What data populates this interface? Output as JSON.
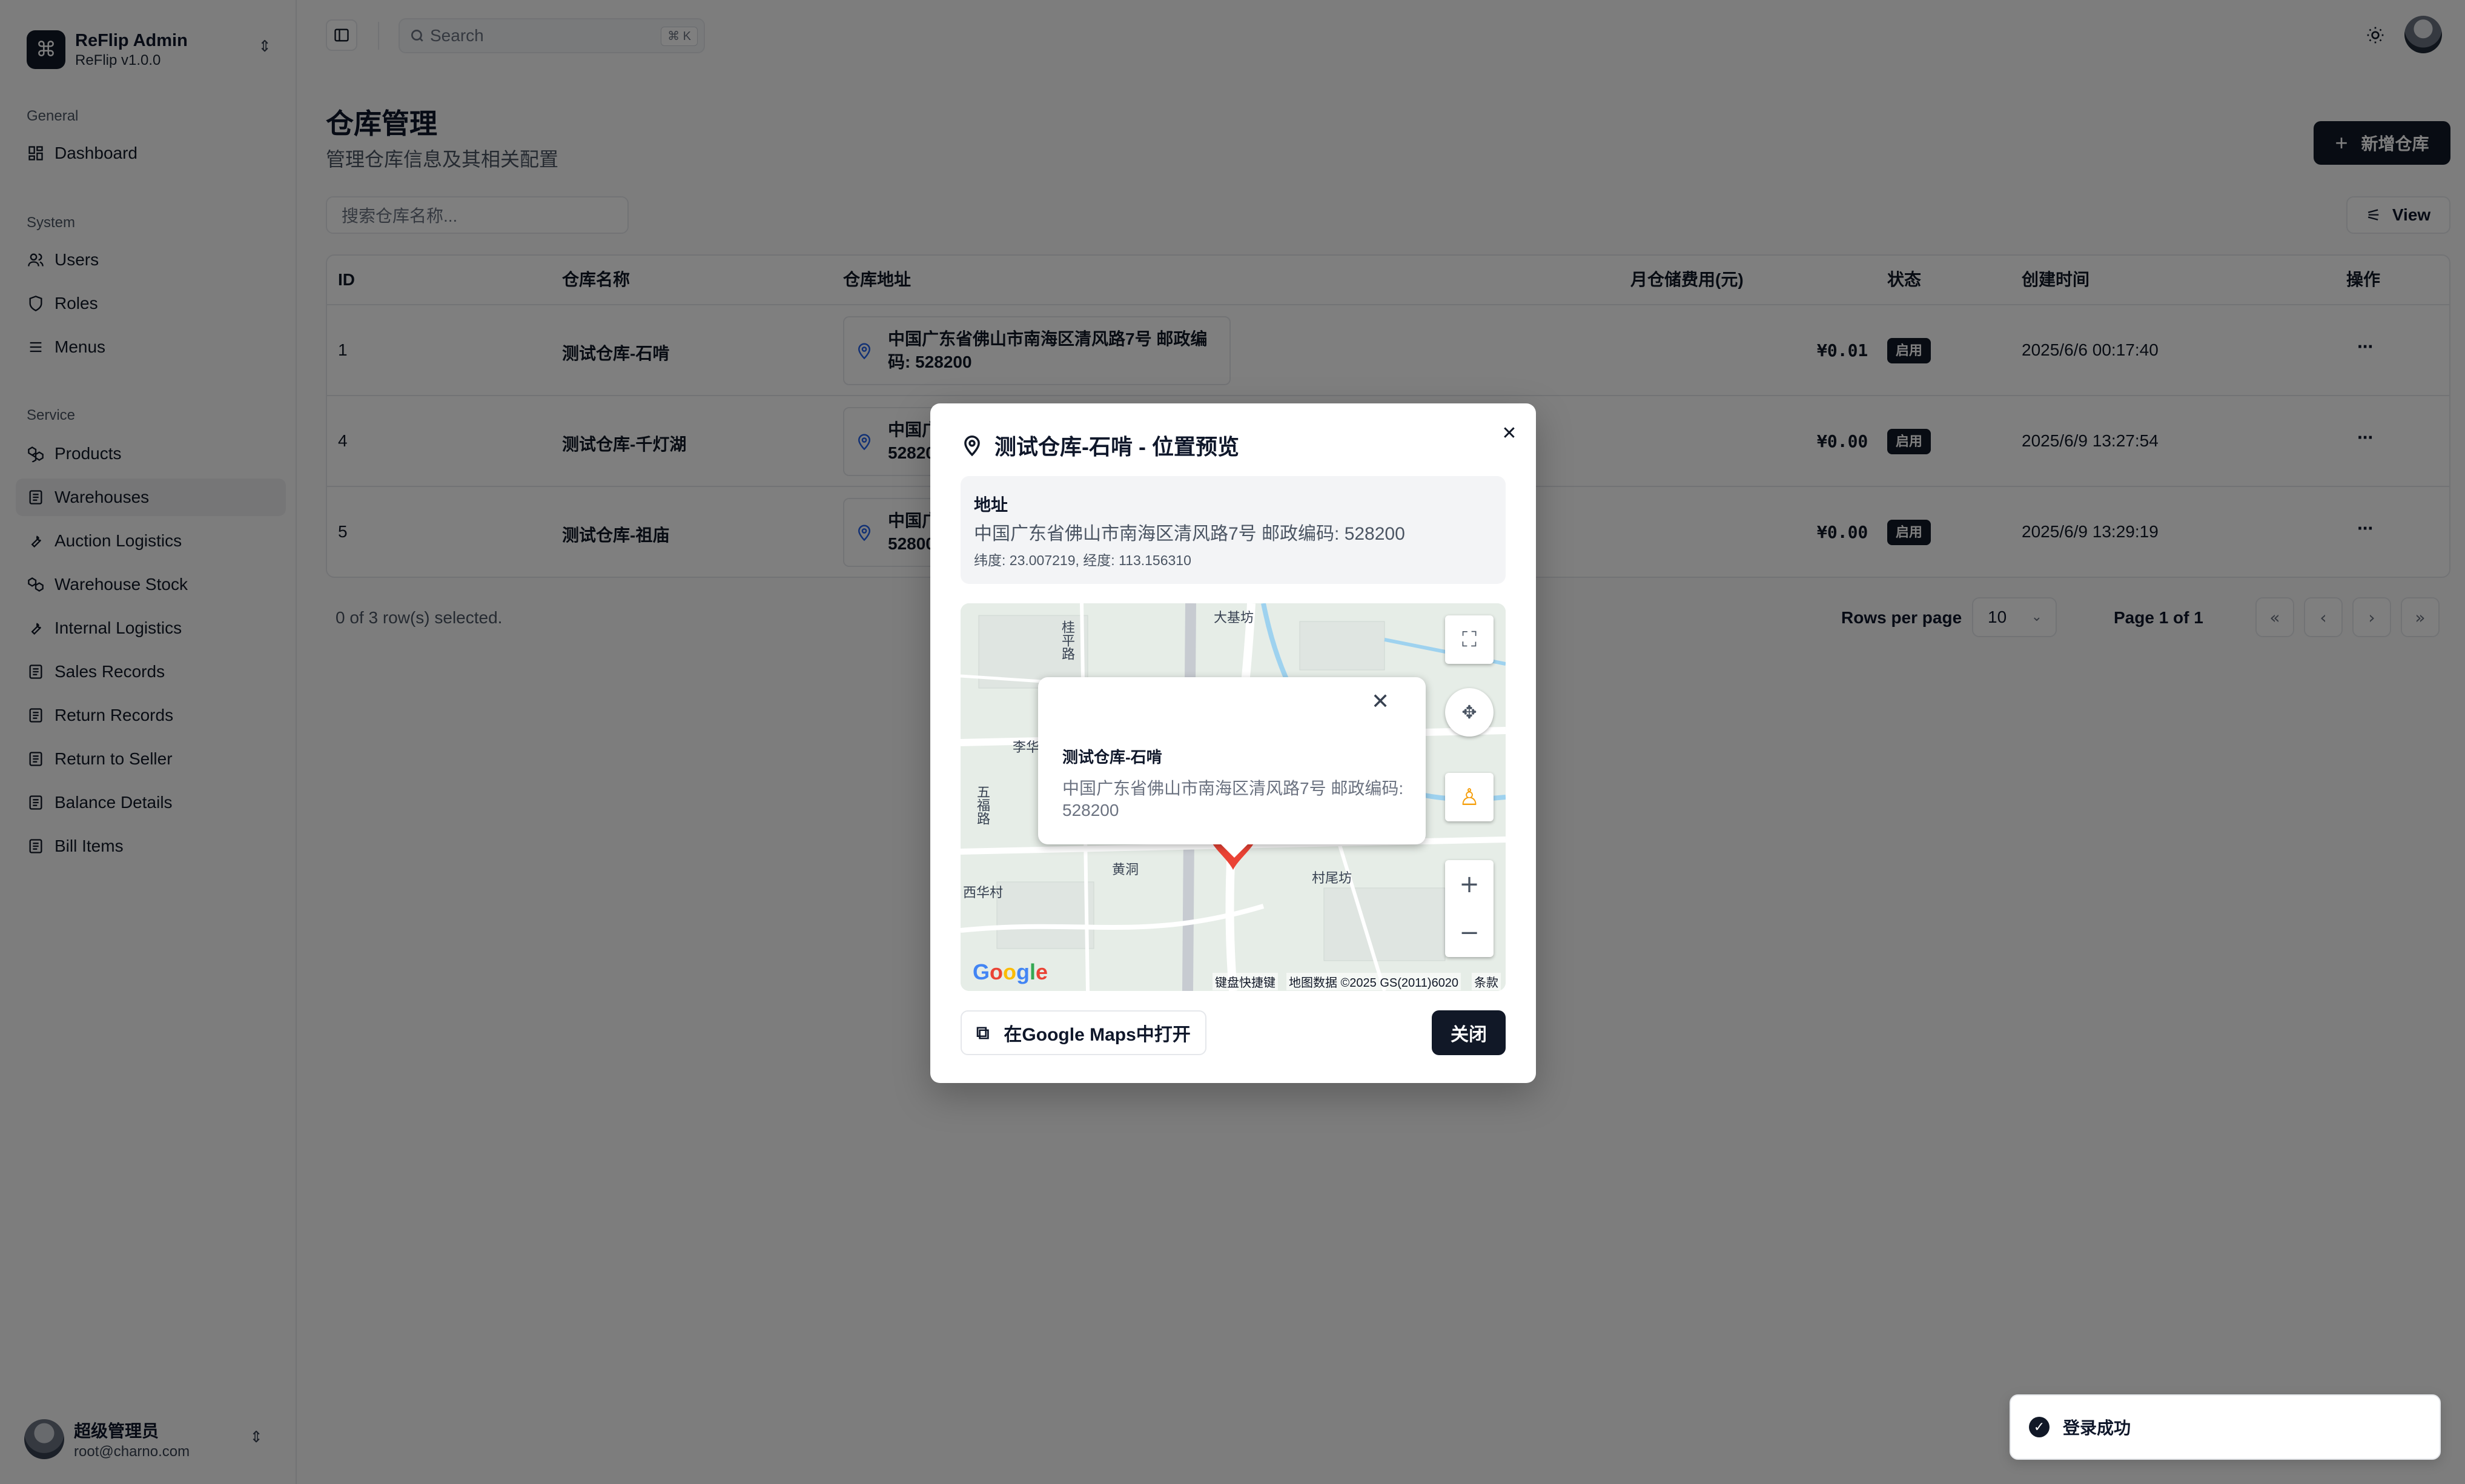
{
  "brand": {
    "title": "ReFlip Admin",
    "version": "ReFlip v1.0.0",
    "logo_glyph": "⌘"
  },
  "sidebar": {
    "groups": [
      {
        "label": "General",
        "items": [
          {
            "label": "Dashboard",
            "icon": "dashboard-icon"
          }
        ]
      },
      {
        "label": "System",
        "items": [
          {
            "label": "Users",
            "icon": "users-icon"
          },
          {
            "label": "Roles",
            "icon": "shield-icon"
          },
          {
            "label": "Menus",
            "icon": "menu-icon"
          }
        ]
      },
      {
        "label": "Service",
        "items": [
          {
            "label": "Products",
            "icon": "boxes-icon"
          },
          {
            "label": "Warehouses",
            "icon": "clipboard-icon",
            "active": true
          },
          {
            "label": "Auction Logistics",
            "icon": "wrench-icon"
          },
          {
            "label": "Warehouse Stock",
            "icon": "boxes-icon"
          },
          {
            "label": "Internal Logistics",
            "icon": "wrench-icon"
          },
          {
            "label": "Sales Records",
            "icon": "clipboard-icon"
          },
          {
            "label": "Return Records",
            "icon": "clipboard-icon"
          },
          {
            "label": "Return to Seller",
            "icon": "clipboard-icon"
          },
          {
            "label": "Balance Details",
            "icon": "clipboard-icon"
          },
          {
            "label": "Bill Items",
            "icon": "clipboard-icon"
          }
        ]
      }
    ]
  },
  "user": {
    "name": "超级管理员",
    "email": "root@charno.com"
  },
  "topbar": {
    "search_placeholder": "Search",
    "search_shortcut": "⌘ K"
  },
  "page": {
    "title": "仓库管理",
    "subtitle": "管理仓库信息及其相关配置",
    "add_button": "新增仓库",
    "filter_placeholder": "搜索仓库名称...",
    "view_button": "View"
  },
  "table": {
    "columns": [
      "ID",
      "仓库名称",
      "仓库地址",
      "月仓储费用(元)",
      "状态",
      "创建时间",
      "操作"
    ],
    "rows": [
      {
        "id": "1",
        "name": "测试仓库-石啃",
        "address": "中国广东省佛山市南海区清风路7号 邮政编码: 528200",
        "fee": "¥0.01",
        "status": "启用",
        "created": "2025/6/6 00:17:40"
      },
      {
        "id": "4",
        "name": "测试仓库-千灯湖",
        "address": "中国广东省佛山市南海区千灯湖 邮政编码: 528200",
        "fee": "¥0.00",
        "status": "启用",
        "created": "2025/6/9 13:27:54"
      },
      {
        "id": "5",
        "name": "测试仓库-祖庙",
        "address": "中国广东省佛山市禅城区祖庙 邮政编码: 528000",
        "fee": "¥0.00",
        "status": "启用",
        "created": "2025/6/9 13:29:19"
      }
    ]
  },
  "pagination": {
    "selected": "0 of 3 row(s) selected.",
    "rows_per_page_label": "Rows per page",
    "rows_per_page": "10",
    "page_info": "Page 1 of 1"
  },
  "modal": {
    "title": "测试仓库-石啃 - 位置预览",
    "address_label": "地址",
    "address": "中国广东省佛山市南海区清风路7号 邮政编码: 528200",
    "coords": "纬度: 23.007219, 经度: 113.156310",
    "popup_title": "测试仓库-石啃",
    "popup_address": "中国广东省佛山市南海区清风路7号 邮政编码: 528200",
    "map_labels": [
      "大基坊",
      "李华",
      "黄洞",
      "西华村",
      "村尾坊",
      "五福路",
      "桂平路"
    ],
    "map_footer": {
      "shortcuts": "键盘快捷键",
      "data": "地图数据 ©2025 GS(2011)6020",
      "terms": "条款"
    },
    "google_logo": "Google",
    "open_button": "在Google Maps中打开",
    "close_button": "关闭"
  },
  "toast": {
    "message": "登录成功"
  }
}
